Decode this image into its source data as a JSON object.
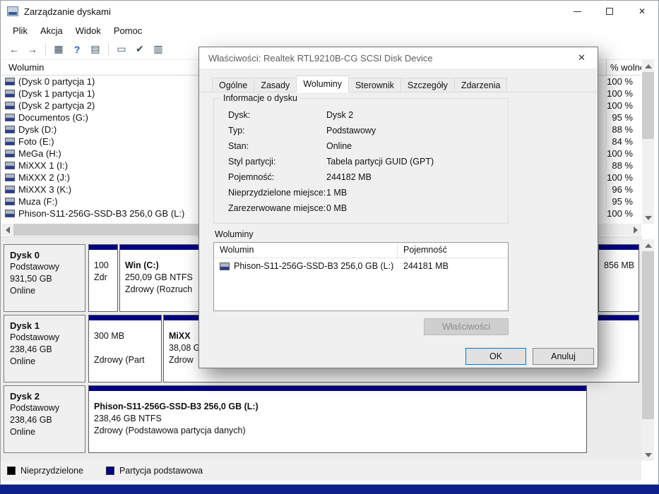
{
  "colors": {
    "primary_partition": "#000082",
    "unallocated": "#000000",
    "taskbar": "#0d1f8b"
  },
  "window": {
    "title": "Zarządzanie dyskami",
    "menu": [
      "Plik",
      "Akcja",
      "Widok",
      "Pomoc"
    ],
    "controls": {
      "close_glyph": "✕"
    }
  },
  "toolbar": {
    "icons": [
      {
        "name": "back",
        "glyph": "←"
      },
      {
        "name": "forward",
        "glyph": "→"
      },
      {
        "name": "console-tree",
        "glyph": "▦"
      },
      {
        "name": "help",
        "glyph": "?"
      },
      {
        "name": "properties",
        "glyph": "▤"
      },
      {
        "name": "action-pane",
        "glyph": "▭"
      },
      {
        "name": "check-disk",
        "glyph": "✔"
      },
      {
        "name": "graph-view",
        "glyph": "▥"
      }
    ]
  },
  "volume_list": {
    "header": {
      "name": "Wolumin",
      "free": "% wolnej"
    },
    "rows": [
      {
        "name": "(Dysk 0 partycja 1)",
        "free": "100 %"
      },
      {
        "name": "(Dysk 1 partycja 1)",
        "free": "100 %"
      },
      {
        "name": "(Dysk 2 partycja 2)",
        "free": "100 %"
      },
      {
        "name": "Documentos (G:)",
        "free": "95 %"
      },
      {
        "name": "Dysk (D:)",
        "free": "88 %"
      },
      {
        "name": "Foto (E:)",
        "free": "84 %"
      },
      {
        "name": "MeGa (H:)",
        "free": "100 %"
      },
      {
        "name": "MiXXX 1 (I:)",
        "free": "88 %"
      },
      {
        "name": "MiXXX 2 (J:)",
        "free": "100 %"
      },
      {
        "name": "MiXXX 3 (K:)",
        "free": "96 %"
      },
      {
        "name": "Muza (F:)",
        "free": "95 %"
      },
      {
        "name": "Phison-S11-256G-SSD-B3 256,0 GB (L:)",
        "free": "100 %"
      }
    ]
  },
  "disks": [
    {
      "name": "Dysk 0",
      "type": "Podstawowy",
      "size": "931,50 GB",
      "status": "Online",
      "partitions": [
        {
          "lines": [
            "100",
            "Zdr",
            ""
          ]
        },
        {
          "lines": [
            "Win (C:)",
            "250,09 GB NTFS",
            "Zdrowy (Rozruch"
          ]
        },
        {
          "lines": [
            "856 MB",
            "",
            ""
          ]
        }
      ]
    },
    {
      "name": "Dysk 1",
      "type": "Podstawowy",
      "size": "238,46 GB",
      "status": "Online",
      "partitions": [
        {
          "lines": [
            "300 MB",
            "",
            "Zdrowy (Part"
          ]
        },
        {
          "lines": [
            "MiXX",
            "38,08 G",
            "Zdrow"
          ]
        }
      ]
    },
    {
      "name": "Dysk 2",
      "type": "Podstawowy",
      "size": "238,46 GB",
      "status": "Online",
      "partitions": [
        {
          "lines": [
            "Phison-S11-256G-SSD-B3 256,0 GB (L:)",
            "238,46 GB NTFS",
            "Zdrowy (Podstawowa partycja danych)"
          ]
        }
      ]
    }
  ],
  "legend": {
    "items": [
      {
        "label": "Nieprzydzielone",
        "color": "#000000"
      },
      {
        "label": "Partycja podstawowa",
        "color": "#000082"
      }
    ]
  },
  "dialog": {
    "title": "Właściwości: Realtek RTL9210B-CG SCSI Disk Device",
    "close_glyph": "✕",
    "tabs": [
      "Ogólne",
      "Zasady",
      "Woluminy",
      "Sterownik",
      "Szczegóły",
      "Zdarzenia"
    ],
    "group_title": "Informacje o dysku",
    "info": [
      {
        "label": "Dysk:",
        "value": "Dysk 2"
      },
      {
        "label": "Typ:",
        "value": "Podstawowy"
      },
      {
        "label": "Stan:",
        "value": "Online"
      },
      {
        "label": "Styl partycji:",
        "value": "Tabela partycji GUID (GPT)"
      },
      {
        "label": "Pojemność:",
        "value": "244182 MB"
      },
      {
        "label": "Nieprzydzielone miejsce:",
        "value": "1 MB"
      },
      {
        "label": "Zarezerwowane miejsce:",
        "value": "0 MB"
      }
    ],
    "volumes_label": "Woluminy",
    "table": {
      "col_volume": "Wolumin",
      "col_capacity": "Pojemność",
      "rows": [
        {
          "volume": "Phison-S11-256G-SSD-B3 256,0 GB (L:)",
          "capacity": "244181 MB"
        }
      ]
    },
    "buttons": {
      "properties": "Właściwości",
      "ok": "OK",
      "cancel": "Anuluj"
    }
  }
}
